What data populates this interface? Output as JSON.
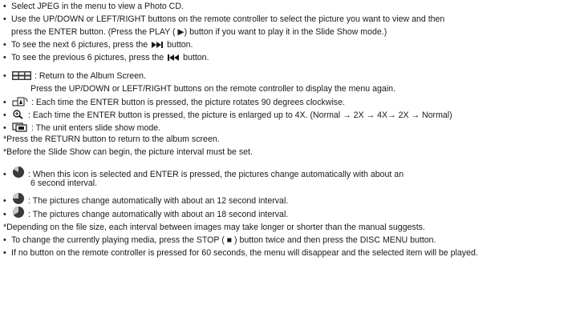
{
  "photo_cd": {
    "l1": "Select JPEG in the menu to view a Photo CD.",
    "l2": "Use the UP/DOWN or LEFT/RIGHT buttons on the remote controller to select the picture you want to view and then",
    "l3": "press the ENTER button. (Press the PLAY ( ▶) button if you want to play it in the Slide Show mode.)",
    "l4a": "To see the next 6 pictures, press the",
    "l4b": "button.",
    "l5a": "To see the previous 6 pictures, press the",
    "l5b": "button."
  },
  "icons": {
    "album_text": ": Return to the Album Screen.",
    "album_text2": "Press the UP/DOWN or LEFT/RIGHT buttons on the remote controller to display the menu again.",
    "rotate_text": ": Each time the ENTER button is pressed, the picture rotates 90 degrees clockwise.",
    "zoom_text": ": Each time the ENTER button is pressed, the picture is enlarged up to 4X. (Normal → 2X → 4X→ 2X → Normal)",
    "slideshow_text": ": The unit enters slide show mode.",
    "note1": "*Press the RETURN button to return to the album screen.",
    "note2": "*Before the Slide Show can begin, the picture interval must be set."
  },
  "intervals": {
    "i1a": ": When this icon is selected and ENTER is pressed, the pictures change automatically with about an",
    "i1b": "6 second interval.",
    "i2": ": The pictures change automatically with about an 12 second interval.",
    "i3": ": The pictures change automatically with about an 18 second interval."
  },
  "footer": {
    "n1": "*Depending on the file size, each interval between images may take longer or shorter than the manual suggests.",
    "n2": "To change the currently playing media, press the STOP ( ■ ) button twice and then press the DISC MENU button.",
    "n3": "If no button on the remote controller is pressed for 60 seconds, the menu will disappear and the selected item will be played."
  },
  "colors": {
    "text": "#1a1a1a",
    "icon_dark": "#3a3a3a",
    "icon_light": "#c8c8c8"
  }
}
